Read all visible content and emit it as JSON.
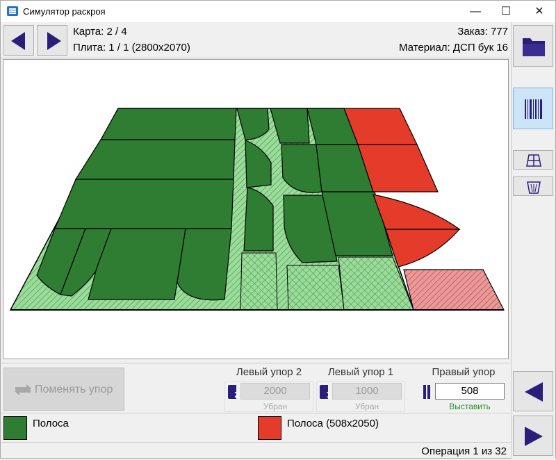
{
  "window": {
    "title": "Симулятор раскроя",
    "minimize": "—",
    "maximize": "☐",
    "close": "✕"
  },
  "header": {
    "map": "Карта: 2 / 4",
    "sheet": "Плита: 1 / 1 (2800x2070)",
    "order": "Заказ: 777",
    "material": "Материал: ДСП бук 16"
  },
  "icons": {
    "prev": "arrow-left-icon",
    "next": "arrow-right-icon",
    "folder": "folder-icon",
    "barcode": "barcode-icon",
    "grid": "grid-icon",
    "trash": "trash-icon",
    "swap": "swap-icon",
    "stop_left2": "stop-left-2-icon",
    "stop_left1": "stop-left-1-icon",
    "stop_right": "stop-right-icon"
  },
  "controls": {
    "swap_label": "Поменять упор",
    "left_stop2": {
      "title": "Левый упор 2",
      "value": "2000",
      "status": "Убран",
      "badge": "2"
    },
    "left_stop1": {
      "title": "Левый упор 1",
      "value": "1000",
      "status": "Убран",
      "badge": "1"
    },
    "right_stop": {
      "title": "Правый упор",
      "value": "508",
      "status": "Выставить"
    }
  },
  "legend": [
    {
      "label": "Полоса",
      "color": "#2e7d32"
    },
    {
      "label": "Полоса (508x2050)",
      "color": "#e53b2a"
    }
  ],
  "status": {
    "operation": "Операция 1 из 32"
  },
  "colors": {
    "part": "#2e7d32",
    "strip": "#e53b2a",
    "waste_green": "#8fd48f",
    "waste_red": "#e08a8a",
    "accent": "#2b1e7a"
  }
}
